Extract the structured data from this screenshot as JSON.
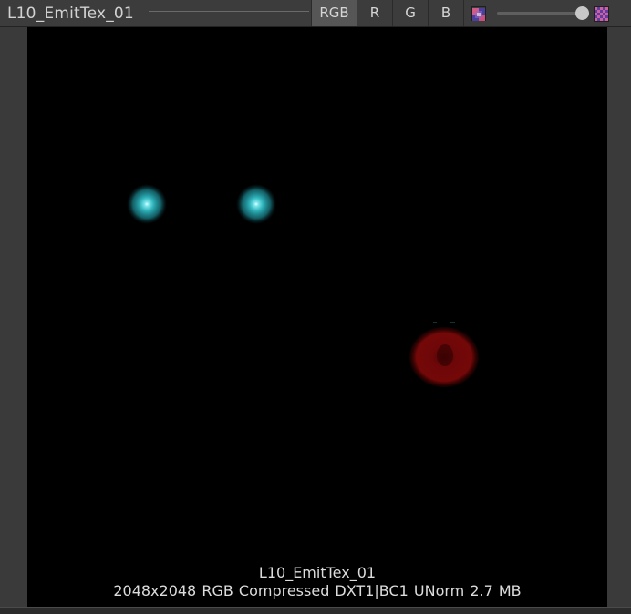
{
  "header": {
    "title": "L10_EmitTex_01",
    "channels": [
      {
        "label": "RGB",
        "active": true
      },
      {
        "label": "R",
        "active": false
      },
      {
        "label": "G",
        "active": false
      },
      {
        "label": "B",
        "active": false
      }
    ],
    "mip_slider": {
      "value": 1.0
    },
    "icons": {
      "small_mip": "checker-small-icon",
      "large_mip": "checker-large-icon"
    }
  },
  "preview": {
    "info_name": "L10_EmitTex_01",
    "info_details": "2048x2048  RGB Compressed DXT1|BC1 UNorm   2.7 MB",
    "colors": {
      "glow_cyan": "#2fb8c0",
      "glow_red": "#7a0808",
      "background": "#000000"
    }
  }
}
